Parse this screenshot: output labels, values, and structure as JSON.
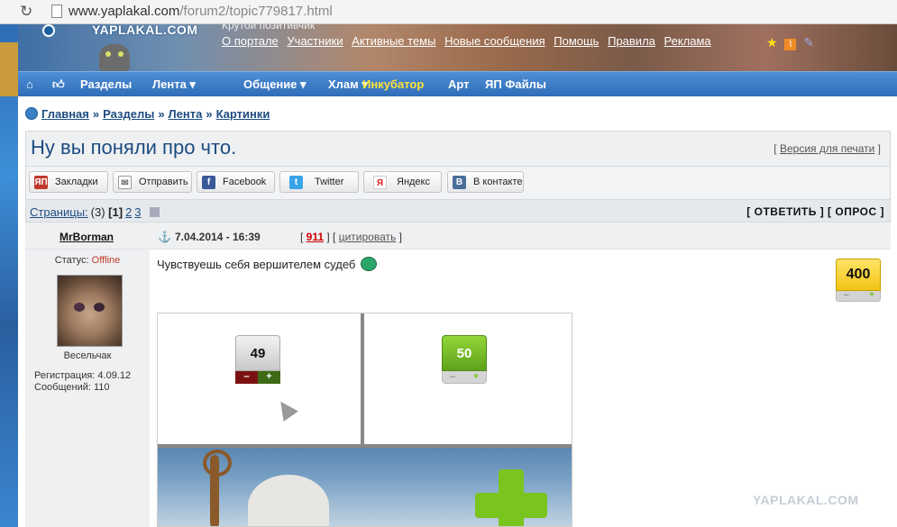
{
  "browser": {
    "url_domain": "www.yaplakal.com",
    "url_path": "/forum2/topic779817.html"
  },
  "header": {
    "logo": "YAPLAKAL.COM",
    "tagline": "Крутой позитивчик",
    "links": [
      "О портале",
      "Участники",
      "Активные темы",
      "Новые сообщения",
      "Помощь",
      "Правила",
      "Реклама"
    ]
  },
  "nav": {
    "items": [
      {
        "label": "Разделы"
      },
      {
        "label": "Лента ▾"
      },
      {
        "label": "Общение ▾"
      },
      {
        "label": "Хлам ▾"
      },
      {
        "label": "Инкубатор"
      },
      {
        "label": "Арт"
      },
      {
        "label": "ЯП Файлы"
      }
    ]
  },
  "breadcrumb": {
    "items": [
      "Главная",
      "Разделы",
      "Лента",
      "Картинки"
    ],
    "separator": "»"
  },
  "topic": {
    "title": "Ну вы поняли про что.",
    "print_link": "Версия для печати"
  },
  "share": {
    "buttons": [
      {
        "label": "Закладки",
        "icon": "ЯП",
        "color": "#c0392b"
      },
      {
        "label": "Отправить",
        "icon": "✉",
        "color": "#888888"
      },
      {
        "label": "Facebook",
        "icon": "f",
        "color": "#3b5998"
      },
      {
        "label": "Twitter",
        "icon": "t",
        "color": "#3aa4e6"
      },
      {
        "label": "Яндекс",
        "icon": "Я",
        "color": "#e02020"
      },
      {
        "label": "В контакте",
        "icon": "В",
        "color": "#4a6e9a"
      }
    ]
  },
  "pages": {
    "label": "Страницы:",
    "count": "(3)",
    "current": "[1]",
    "others": [
      "2",
      "3"
    ],
    "actions": "[ ОТВЕТИТЬ ] [ ОПРОС ]"
  },
  "post": {
    "author": "MrBorman",
    "date": "7.04.2014 - 16:39",
    "number": "911",
    "quote": "цитировать",
    "status_label": "Статус:",
    "status_value": "Offline",
    "rank": "Весельчак",
    "registration": "Регистрация: 4.09.12",
    "messages": "Сообщений: 110",
    "text": "Чувствуешь себя вершителем судеб",
    "rating": "400",
    "rating_minus": "–",
    "rating_plus": "+",
    "image_votes": {
      "left_value": "49",
      "right_value": "50",
      "minus": "–",
      "plus": "+"
    }
  },
  "watermark": "YAPLAKAL.COM"
}
